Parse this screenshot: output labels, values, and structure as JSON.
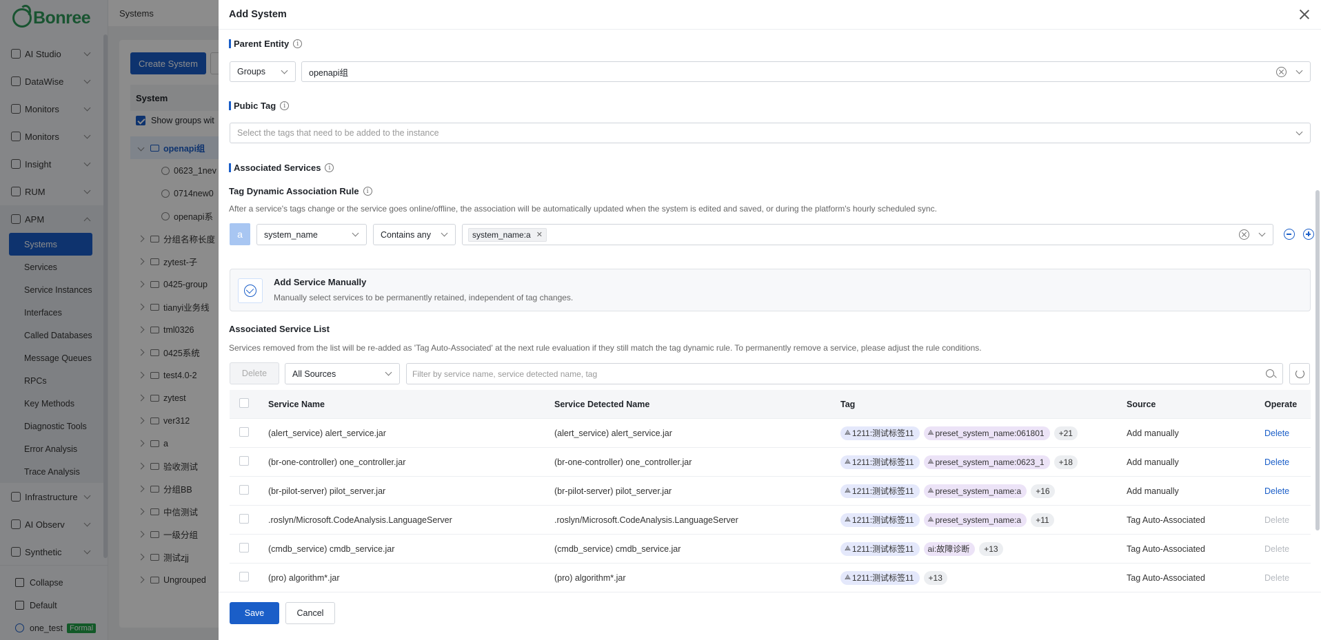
{
  "app": {
    "brand": "Bonree",
    "breadcrumb": "Systems"
  },
  "sidebar": {
    "top_items": [
      {
        "label": "AI Studio"
      },
      {
        "label": "DataWise"
      },
      {
        "label": "Monitors"
      },
      {
        "label": "Monitors"
      },
      {
        "label": "Insight"
      },
      {
        "label": "RUM"
      },
      {
        "label": "APM"
      }
    ],
    "apm_sub": [
      "Systems",
      "Services",
      "Service Instances",
      "Interfaces",
      "Called Databases",
      "Message Queues",
      "RPCs",
      "Key Methods",
      "Diagnostic Tools",
      "Error Analysis",
      "Trace Analysis"
    ],
    "bottom_items": [
      {
        "label": "Infrastructure"
      },
      {
        "label": "AI Observ"
      },
      {
        "label": "Synthetic"
      }
    ],
    "collapse": "Collapse",
    "workspace": "Default",
    "user": "one_test",
    "user_badge": "Formal"
  },
  "systems_page": {
    "create_button": "Create System",
    "tree_header": "System",
    "show_groups": "Show groups wit",
    "tree": [
      {
        "label": "openapi组",
        "kind": "group-open"
      },
      {
        "label": "0623_1nev",
        "kind": "leaf"
      },
      {
        "label": "0714new0",
        "kind": "leaf"
      },
      {
        "label": "openapi系",
        "kind": "leaf"
      },
      {
        "label": "分组名称长度",
        "kind": "group"
      },
      {
        "label": "zytest-子",
        "kind": "group"
      },
      {
        "label": "0425-group",
        "kind": "group"
      },
      {
        "label": "tianyi业务线",
        "kind": "group"
      },
      {
        "label": "tml0326",
        "kind": "group"
      },
      {
        "label": "0425系统",
        "kind": "group"
      },
      {
        "label": "test4.0-2",
        "kind": "group"
      },
      {
        "label": "zytest",
        "kind": "group"
      },
      {
        "label": "ver312",
        "kind": "group"
      },
      {
        "label": "a",
        "kind": "group"
      },
      {
        "label": "验收测试",
        "kind": "group"
      },
      {
        "label": "分组BB",
        "kind": "group"
      },
      {
        "label": "中信测试",
        "kind": "group"
      },
      {
        "label": "一级分组",
        "kind": "group"
      },
      {
        "label": "测试zjj",
        "kind": "group"
      },
      {
        "label": "Ungrouped",
        "kind": "group"
      }
    ]
  },
  "drawer": {
    "title": "Add System",
    "parent_entity": {
      "label": "Parent Entity",
      "type_value": "Groups",
      "value": "openapi组"
    },
    "public_tag": {
      "label": "Pubic Tag",
      "placeholder": "Select the tags that need to be added to the instance"
    },
    "associated_services": {
      "label": "Associated Services",
      "rule_title": "Tag Dynamic Association Rule",
      "rule_desc": "After a service's tags change or the service goes online/offline, the association will be automatically updated when the system is edited and saved, or during the platform's hourly scheduled sync.",
      "rule": {
        "letter": "a",
        "field": "system_name",
        "operator": "Contains any",
        "values": [
          "system_name:a"
        ]
      },
      "manual": {
        "title": "Add Service Manually",
        "desc": "Manually select services to be permanently retained, independent of tag changes."
      },
      "list_title": "Associated Service List",
      "list_desc": "Services removed from the list will be re-added as 'Tag Auto-Associated' at the next rule evaluation if they still match the tag dynamic rule. To permanently remove a service, please adjust the rule conditions.",
      "delete_label": "Delete",
      "source_filter": "All Sources",
      "search_placeholder": "Filter by service name, service detected name, tag",
      "columns": [
        "Service Name",
        "Service Detected Name",
        "Tag",
        "Source",
        "Operate"
      ],
      "rows": [
        {
          "name": "(alert_service) alert_service.jar",
          "detected": "(alert_service) alert_service.jar",
          "tag1": "1211:测试标签11",
          "tag2": "preset_system_name:061801",
          "more": "+21",
          "source": "Add manually",
          "op": "Delete",
          "op_enabled": true,
          "tag2_style": "pur"
        },
        {
          "name": "(br-one-controller) one_controller.jar",
          "detected": "(br-one-controller) one_controller.jar",
          "tag1": "1211:测试标签11",
          "tag2": "preset_system_name:0623_1",
          "more": "+18",
          "source": "Add manually",
          "op": "Delete",
          "op_enabled": true,
          "tag2_style": "pur"
        },
        {
          "name": "(br-pilot-server) pilot_server.jar",
          "detected": "(br-pilot-server) pilot_server.jar",
          "tag1": "1211:测试标签11",
          "tag2": "preset_system_name:a",
          "more": "+16",
          "source": "Add manually",
          "op": "Delete",
          "op_enabled": true,
          "tag2_style": "pur"
        },
        {
          "name": ".roslyn/Microsoft.CodeAnalysis.LanguageServer",
          "detected": ".roslyn/Microsoft.CodeAnalysis.LanguageServer",
          "tag1": "1211:测试标签11",
          "tag2": "preset_system_name:a",
          "more": "+11",
          "source": "Tag Auto-Associated",
          "op": "Delete",
          "op_enabled": false,
          "tag2_style": "pur"
        },
        {
          "name": "(cmdb_service) cmdb_service.jar",
          "detected": "(cmdb_service) cmdb_service.jar",
          "tag1": "1211:测试标签11",
          "tag2": "ai:故障诊断",
          "more": "+13",
          "source": "Tag Auto-Associated",
          "op": "Delete",
          "op_enabled": false,
          "tag2_style": "pur-plain"
        },
        {
          "name": "(pro) algorithm*.jar",
          "detected": "(pro) algorithm*.jar",
          "tag1": "1211:测试标签11",
          "tag2": "",
          "more": "+13",
          "source": "Tag Auto-Associated",
          "op": "Delete",
          "op_enabled": false,
          "tag2_style": ""
        }
      ]
    },
    "footer": {
      "save": "Save",
      "cancel": "Cancel"
    }
  },
  "colors": {
    "primary": "#1a5ec8",
    "tag_blue": "#e4e8fb",
    "tag_purple": "#ece3f7",
    "badge_green": "#21a34a"
  }
}
